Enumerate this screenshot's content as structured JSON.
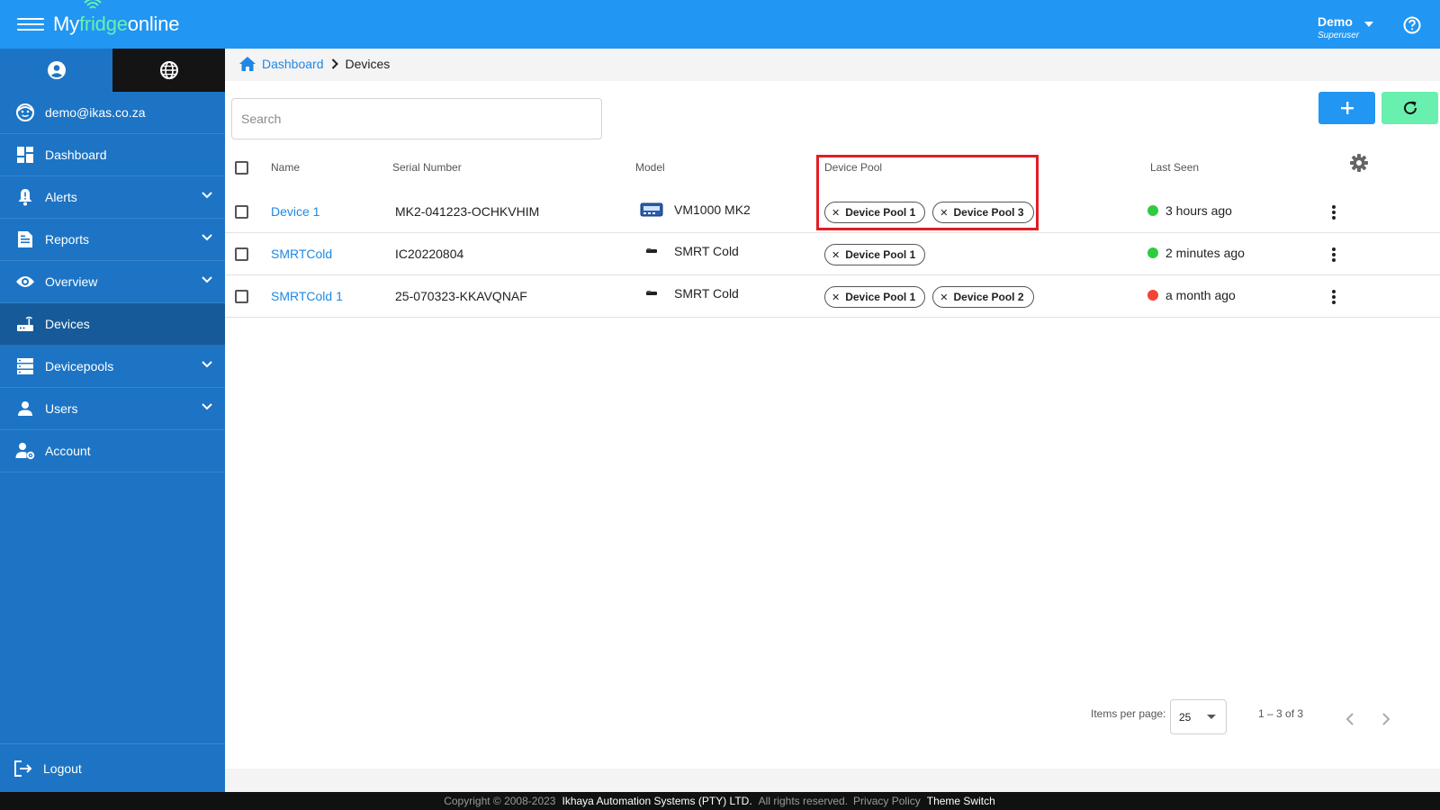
{
  "header": {
    "brand_prefix": "My",
    "brand_accent": "fridge",
    "brand_suffix": "online",
    "user_name": "Demo",
    "user_role": "Superuser"
  },
  "sidebar": {
    "email": "demo@ikas.co.za",
    "items": [
      {
        "label": "Dashboard"
      },
      {
        "label": "Alerts"
      },
      {
        "label": "Reports"
      },
      {
        "label": "Overview"
      },
      {
        "label": "Devices"
      },
      {
        "label": "Devicepools"
      },
      {
        "label": "Users"
      },
      {
        "label": "Account"
      }
    ],
    "logout": "Logout"
  },
  "breadcrumb": {
    "home": "Dashboard",
    "current": "Devices"
  },
  "search": {
    "placeholder": "Search"
  },
  "table": {
    "columns": [
      "Name",
      "Serial Number",
      "Model",
      "Device Pool",
      "Last Seen"
    ],
    "rows": [
      {
        "name": "Device 1",
        "serial": "MK2-041223-OCHKVHIM",
        "model": "VM1000 MK2",
        "pools": [
          "Device Pool 1",
          "Device Pool 3"
        ],
        "last_seen": "3 hours ago",
        "status": "online"
      },
      {
        "name": "SMRTCold",
        "serial": "IC20220804",
        "model": "SMRT Cold",
        "pools": [
          "Device Pool 1"
        ],
        "last_seen": "2 minutes ago",
        "status": "online"
      },
      {
        "name": "SMRTCold 1",
        "serial": "25-070323-KKAVQNAF",
        "model": "SMRT Cold",
        "pools": [
          "Device Pool 1",
          "Device Pool 2"
        ],
        "last_seen": "a month ago",
        "status": "offline"
      }
    ]
  },
  "pagination": {
    "items_per_page_label": "Items per page:",
    "items_per_page": "25",
    "range": "1 – 3 of 3"
  },
  "footer": {
    "copyright": "Copyright © 2008-2023",
    "company": "Ikhaya Automation Systems (PTY) LTD.",
    "rights": "All rights reserved.",
    "privacy": "Privacy Policy",
    "theme": "Theme Switch"
  },
  "colors": {
    "header": "#2196f3",
    "sidebar": "#1d74c4",
    "sidebar_active": "#165a99",
    "accent_green": "#69f0ae",
    "status_online": "#2ecc40",
    "status_offline": "#f44336",
    "highlight": "#e31c25"
  }
}
